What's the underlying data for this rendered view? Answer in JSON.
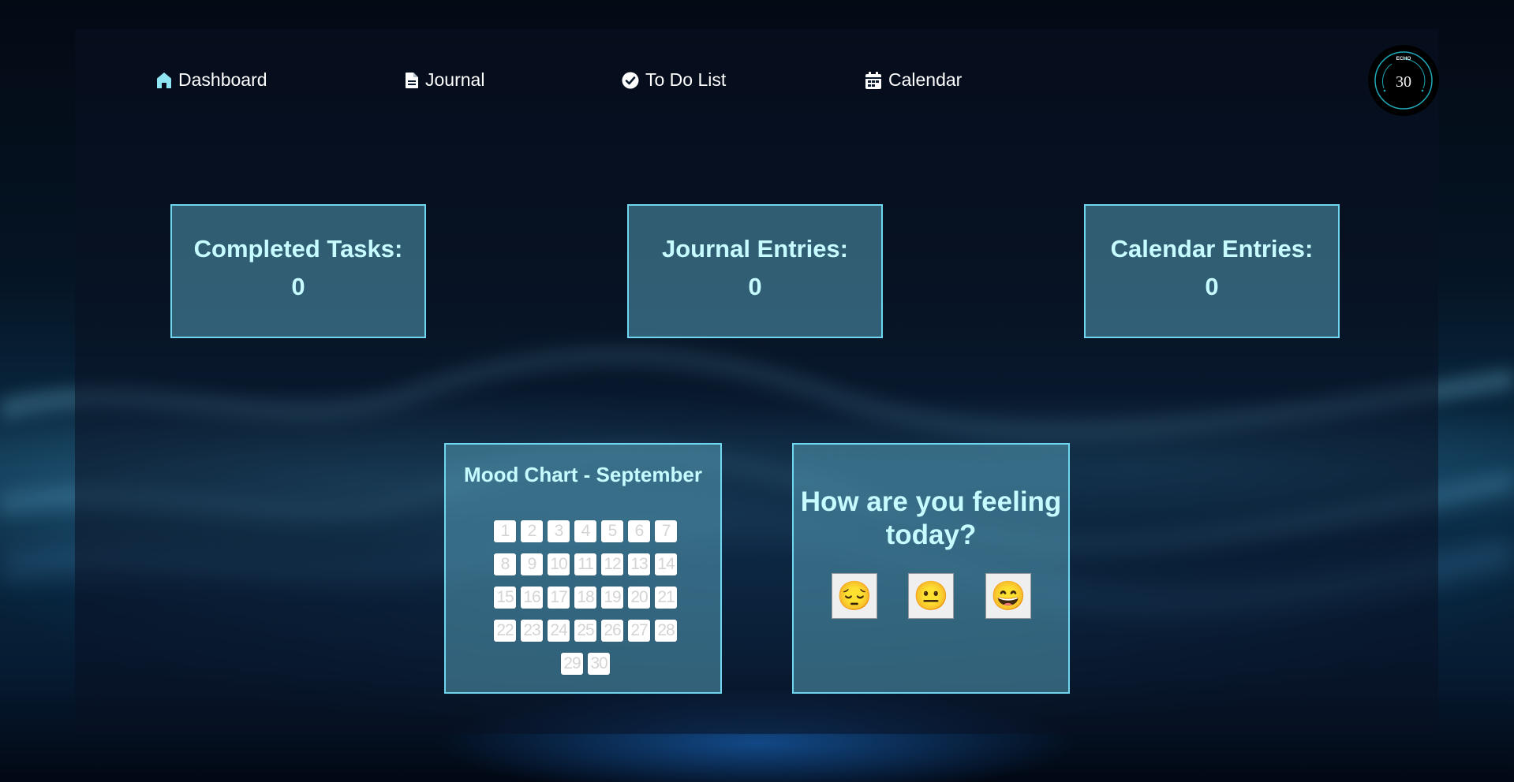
{
  "nav": {
    "dashboard": "Dashboard",
    "journal": "Journal",
    "todo": "To Do List",
    "calendar": "Calendar"
  },
  "logo": {
    "brand": "ECHO",
    "number": "30"
  },
  "stats": {
    "completed_label": "Completed Tasks:",
    "completed_value": "0",
    "journal_label": "Journal Entries:",
    "journal_value": "0",
    "calendar_label": "Calendar Entries:",
    "calendar_value": "0"
  },
  "mood_chart": {
    "title": "Mood Chart - September",
    "days": [
      "1",
      "2",
      "3",
      "4",
      "5",
      "6",
      "7",
      "8",
      "9",
      "10",
      "11",
      "12",
      "13",
      "14",
      "15",
      "16",
      "17",
      "18",
      "19",
      "20",
      "21",
      "22",
      "23",
      "24",
      "25",
      "26",
      "27",
      "28",
      "29",
      "30"
    ]
  },
  "feeling": {
    "question": "How are you feeling today?",
    "options": [
      "😔",
      "😐",
      "😄"
    ]
  },
  "colors": {
    "accent": "#6fd6f0",
    "card_text": "#c6fbff",
    "icon": "#8fe6f2"
  },
  "icons": [
    "home-icon",
    "document-icon",
    "check-circle-icon",
    "calendar-icon"
  ]
}
